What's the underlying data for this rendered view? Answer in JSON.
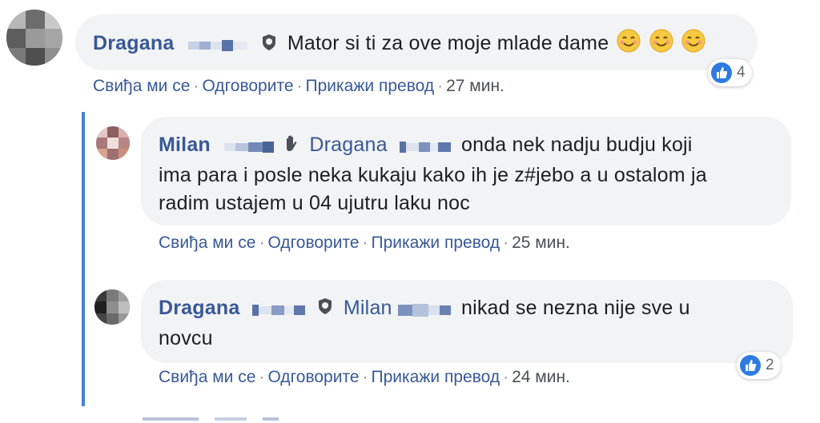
{
  "comments": [
    {
      "author": "Dragana",
      "mention": "",
      "lines": [
        "Mator si ti za ove moje mlade dame"
      ],
      "reaction_count": "4",
      "actions": {
        "like": "Свиђа ми се",
        "reply": "Одговорите",
        "translate": "Прикажи превод",
        "time": "27 мин."
      }
    },
    {
      "author": "Milan",
      "mention": "Dragana",
      "lines": [
        "onda nek nadju budju koji",
        "ima para i posle neka kukaju kako ih je z#jebo a u ostalom ja",
        "radim ustajem u 04 ujutru laku noc"
      ],
      "actions": {
        "like": "Свиђа ми се",
        "reply": "Одговорите",
        "translate": "Прикажи превод",
        "time": "25 мин."
      }
    },
    {
      "author": "Dragana",
      "mention": "Milan",
      "lines": [
        "nikad se nezna nije sve u",
        "novcu"
      ],
      "reaction_count": "2",
      "actions": {
        "like": "Свиђа ми се",
        "reply": "Одговорите",
        "translate": "Прикажи превод",
        "time": "24 мин."
      }
    }
  ],
  "icons": [
    "shield-icon",
    "wave-hand-icon",
    "smile-emoji-icon",
    "like-icon"
  ],
  "colors": {
    "link": "#385898",
    "bubble": "#f2f3f5",
    "like": "#2e7be0",
    "thread": "#4a7fd6"
  }
}
